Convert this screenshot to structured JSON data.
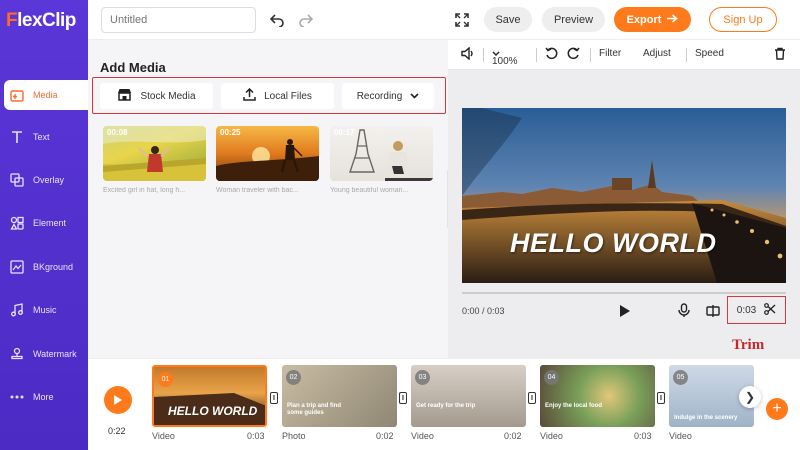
{
  "brand": {
    "logo_first": "F",
    "logo_rest": "lexClip"
  },
  "sidebar": {
    "items": [
      {
        "label": "Media",
        "icon": "media-icon",
        "active": true
      },
      {
        "label": "Text",
        "icon": "text-icon"
      },
      {
        "label": "Overlay",
        "icon": "overlay-icon"
      },
      {
        "label": "Element",
        "icon": "element-icon"
      },
      {
        "label": "BKground",
        "icon": "background-icon"
      },
      {
        "label": "Music",
        "icon": "music-icon"
      },
      {
        "label": "Watermark",
        "icon": "watermark-icon"
      },
      {
        "label": "More",
        "icon": "more-icon"
      }
    ]
  },
  "topbar": {
    "title_placeholder": "Untitled",
    "save_label": "Save",
    "preview_label": "Preview",
    "export_label": "Export",
    "signup_label": "Sign Up"
  },
  "media": {
    "heading": "Add Media",
    "stock_label": "Stock Media",
    "local_label": "Local Files",
    "recording_label": "Recording",
    "thumbs": [
      {
        "duration": "00:08",
        "caption": "Excited girl in hat, long h..."
      },
      {
        "duration": "00:25",
        "caption": "Woman traveler with bac..."
      },
      {
        "duration": "00:17",
        "caption": "Young beautiful woman..."
      }
    ]
  },
  "preview": {
    "zoom": "100%",
    "filter_label": "Filter",
    "adjust_label": "Adjust",
    "speed_label": "Speed",
    "overlay_text": "HELLO WORLD",
    "time_current": "0:00 / 0:03",
    "trim_duration": "0:03",
    "trim_caption": "Trim"
  },
  "timeline": {
    "total_time": "0:22",
    "clips": [
      {
        "num": "01",
        "type": "Video",
        "duration": "0:03",
        "text": "HELLO WORLD",
        "active": true
      },
      {
        "num": "02",
        "type": "Photo",
        "duration": "0:02",
        "text": "Plan a trip and find some guides"
      },
      {
        "num": "03",
        "type": "Video",
        "duration": "0:02",
        "text": "Get ready for the trip"
      },
      {
        "num": "04",
        "type": "Video",
        "duration": "0:03",
        "text": "Enjoy the local food"
      },
      {
        "num": "05",
        "type": "Video",
        "duration": "",
        "text": "Indulge in the scenery"
      }
    ]
  },
  "colors": {
    "accent": "#ff7a1a",
    "sidebar": "#5b36d8",
    "highlight": "#d9363e"
  }
}
